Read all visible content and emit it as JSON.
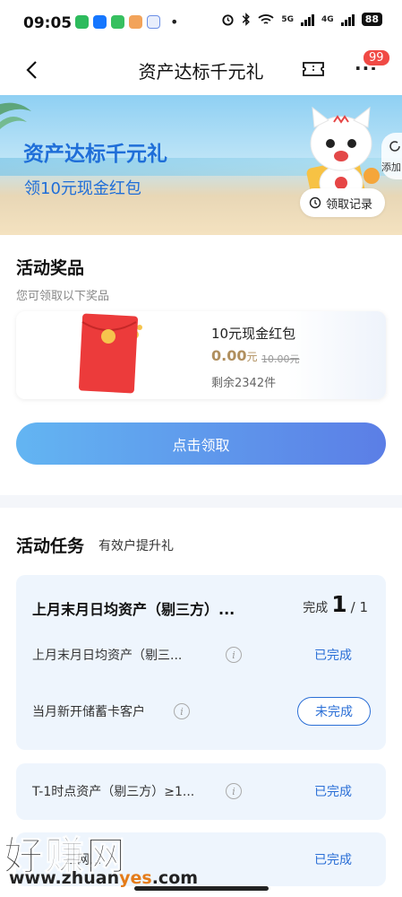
{
  "status_bar": {
    "time": "09:05",
    "battery": "88",
    "network_a": "5G",
    "network_b": "4G"
  },
  "nav": {
    "title": "资产达标千元礼",
    "badge": "99"
  },
  "banner": {
    "title": "资产达标千元礼",
    "subtitle": "领10元现金红包",
    "side_label": "添加",
    "record_label": "领取记录"
  },
  "prize": {
    "section_title": "活动奖品",
    "section_sub": "您可领取以下奖品",
    "name": "10元现金红包",
    "price": "0.00",
    "price_unit": "元",
    "original_price": "10.00元",
    "remaining": "剩余2342件",
    "claim_button": "点击领取"
  },
  "tasks": {
    "title": "活动任务",
    "subtitle": "有效户提升礼",
    "card1": {
      "title": "上月末月日均资产（剔三方）...",
      "progress_label": "完成",
      "progress_done": "1",
      "progress_total": "/ 1",
      "rows": [
        {
          "label": "上月末月日均资产（剔三...",
          "status": "已完成"
        },
        {
          "label": "当月新开储蓄卡客户",
          "status": "未完成"
        }
      ]
    },
    "card2": {
      "label": "T-1时点资产（剔三方）≥1...",
      "status": "已完成"
    },
    "card3": {
      "label": "三网...",
      "status": "已完成"
    }
  },
  "watermark": {
    "brand": "好赚网",
    "url_pre": "www.zhuan",
    "url_mid": "yes",
    "url_post": ".com"
  },
  "colors": {
    "accent_blue": "#2b6fd6",
    "badge_red": "#f04a45",
    "price_gold": "#b08f5e"
  }
}
